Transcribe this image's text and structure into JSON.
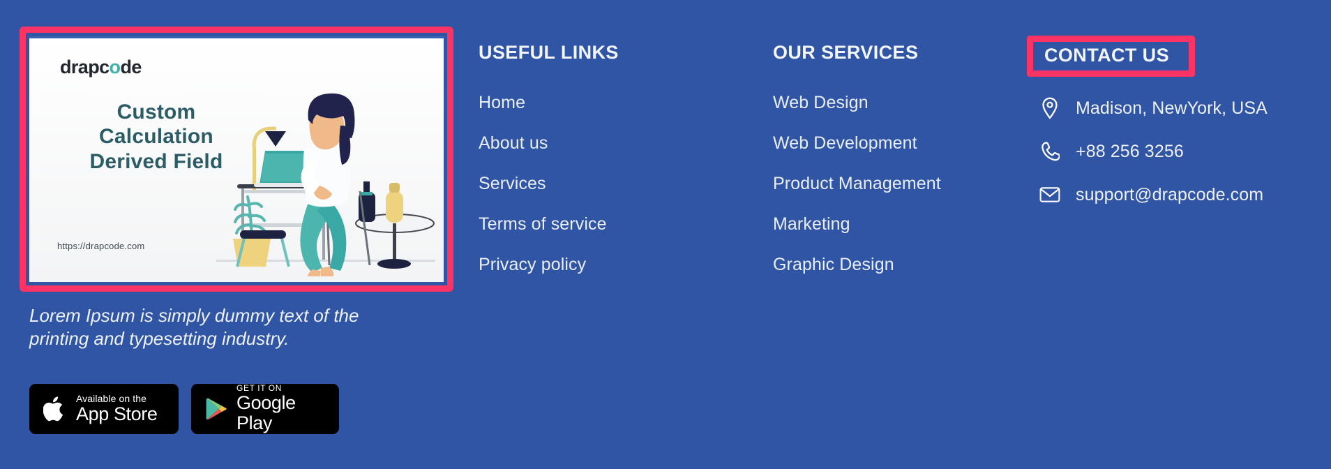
{
  "theme": {
    "background": "#2f55a4",
    "highlight_border": "#fb3465",
    "text": "#eef1f8",
    "card_text": "#2c5c66",
    "logo_accent": "#3fb1ab"
  },
  "brand_column": {
    "promo_card": {
      "logo_prefix": "drapc",
      "logo_accent_letter": "o",
      "logo_suffix": "de",
      "headline": "Custom Calculation Derived Field",
      "url": "https://drapcode.com",
      "illustration_alt": "woman-working-on-laptop-illustration"
    },
    "caption": "Lorem Ipsum is simply dummy text of the printing and typesetting industry.",
    "badges": [
      {
        "name": "app-store",
        "top_label": "Available on the",
        "bottom_label": "App Store"
      },
      {
        "name": "google-play",
        "top_label": "GET IT ON",
        "bottom_label": "Google Play"
      }
    ]
  },
  "useful_links": {
    "heading": "USEFUL LINKS",
    "items": [
      {
        "label": "Home"
      },
      {
        "label": "About us"
      },
      {
        "label": "Services"
      },
      {
        "label": "Terms of service"
      },
      {
        "label": "Privacy policy"
      }
    ]
  },
  "our_services": {
    "heading": "OUR SERVICES",
    "items": [
      {
        "label": "Web Design"
      },
      {
        "label": "Web Development"
      },
      {
        "label": "Product Management"
      },
      {
        "label": "Marketing"
      },
      {
        "label": "Graphic Design"
      }
    ]
  },
  "contact_us": {
    "heading": "CONTACT US",
    "items": [
      {
        "icon": "location-pin-icon",
        "label": "Madison, NewYork, USA"
      },
      {
        "icon": "phone-icon",
        "label": "+88 256 3256"
      },
      {
        "icon": "envelope-icon",
        "label": "support@drapcode.com"
      }
    ]
  }
}
